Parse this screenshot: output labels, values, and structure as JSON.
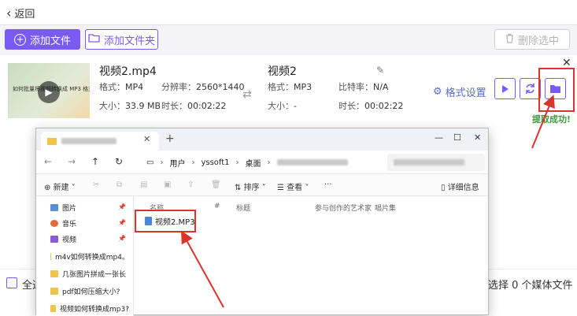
{
  "header": {
    "back_label": "返回"
  },
  "toolbar": {
    "add_file": "添加文件",
    "add_folder": "添加文件夹",
    "delete_selected": "删除选中"
  },
  "item": {
    "source": {
      "name": "视频2.mp4",
      "format_label": "格式：",
      "format": "MP4",
      "resolution_label": "分辨率：",
      "resolution": "2560*1440",
      "size_label": "大小：",
      "size": "33.9 MB",
      "duration_label": "时长：",
      "duration": "00:02:22"
    },
    "target": {
      "name": "视频2",
      "format_label": "格式：",
      "format": "MP3",
      "bitrate_label": "比特率：",
      "bitrate": "N/A",
      "size_label": "大小：",
      "size": "-",
      "duration_label": "时长：",
      "duration": "00:02:22"
    },
    "format_settings": "格式设置",
    "thumbnail_caption": "如何批量将视频转换成 MP3 格式？",
    "success_message": "提取成功!"
  },
  "bottom": {
    "select_all": "全选",
    "selected_count": "选择 0 个媒体文件"
  },
  "explorer": {
    "breadcrumbs": [
      "用户",
      "yssoft1",
      "桌面"
    ],
    "commands": {
      "new": "新建",
      "sort": "排序",
      "view": "查看",
      "more": "···",
      "details": "详细信息"
    },
    "columns": [
      "名称",
      "#",
      "标题",
      "参与创作的艺术家",
      "唱片集"
    ],
    "sidebar": [
      {
        "label": "图片",
        "icon": "pictures-icon",
        "pinned": true
      },
      {
        "label": "音乐",
        "icon": "music-icon",
        "pinned": true
      },
      {
        "label": "视频",
        "icon": "videos-icon",
        "pinned": true
      },
      {
        "label": "m4v如何转换成mp4。",
        "icon": "folder-icon",
        "pinned": false
      },
      {
        "label": "几张图片拼成一张长",
        "icon": "folder-icon",
        "pinned": false
      },
      {
        "label": "pdf如何压缩大小?",
        "icon": "folder-icon",
        "pinned": false
      },
      {
        "label": "视频如何转换成mp3?",
        "icon": "folder-icon",
        "pinned": false
      }
    ],
    "file": "视频2.MP3"
  },
  "colors": {
    "accent": "#7a5af5",
    "highlight": "#d9342b",
    "success": "#3e9b3e"
  }
}
